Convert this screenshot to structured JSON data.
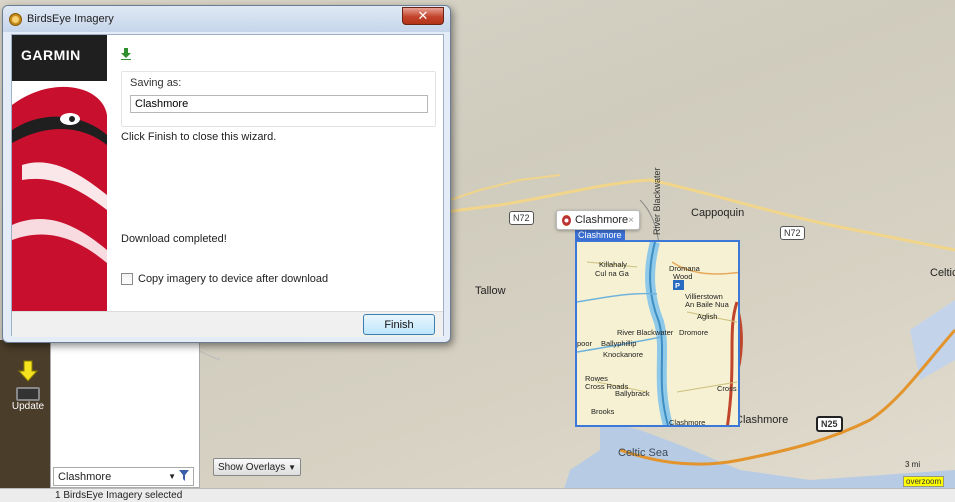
{
  "dialog": {
    "title": "BirdsEye Imagery",
    "close_glyph": "✕",
    "brand": "GARMIN",
    "saving_label": "Saving as:",
    "filename_value": "Clashmore",
    "finish_hint": "Click Finish to close this wizard.",
    "completed": "Download completed!",
    "copy_label": "Copy imagery to device after download",
    "finish_label": "Finish"
  },
  "map": {
    "bubble_label": "Clashmore",
    "bubble_close": "×",
    "tile_label": "Clashmore",
    "places": {
      "cappoquin": "Cappoquin",
      "tallow": "Tallow",
      "clashmore": "Clashmore",
      "celtic_sea": "Celtic Sea",
      "celtic_edge": "Celtic"
    },
    "roads": {
      "n72_west": "N72",
      "n72_east": "N72",
      "n25": "N25"
    },
    "river": "River Blackwater",
    "tile_text": {
      "killahaly": "Killahaly",
      "cul_na": "Cul na Ga",
      "dromana": "Dromana",
      "wood": "Wood",
      "villierstown": "Villierstown",
      "baile": "An Baile Nua",
      "aglish": "Aglish",
      "river": "River Blackwater",
      "dromore": "Dromore",
      "ballyphillip": "Ballyphillip",
      "knockanore": "Knockanore",
      "poor": "poor",
      "rowes": "Rowes",
      "cross": "Cross Roads",
      "ballybrack": "Ballybrack",
      "crossr": "Cross",
      "clashmore_t": "Clashmore",
      "brooks": "Brooks",
      "parking": "P"
    },
    "scale": "3 mi",
    "overzoom": "overzoom",
    "overlays_label": "Show Overlays",
    "overlays_caret": "▼"
  },
  "side": {
    "update_label": "Update",
    "combo_value": "Clashmore",
    "combo_caret": "▼"
  },
  "status": {
    "text": "1 BirdsEye Imagery selected"
  }
}
